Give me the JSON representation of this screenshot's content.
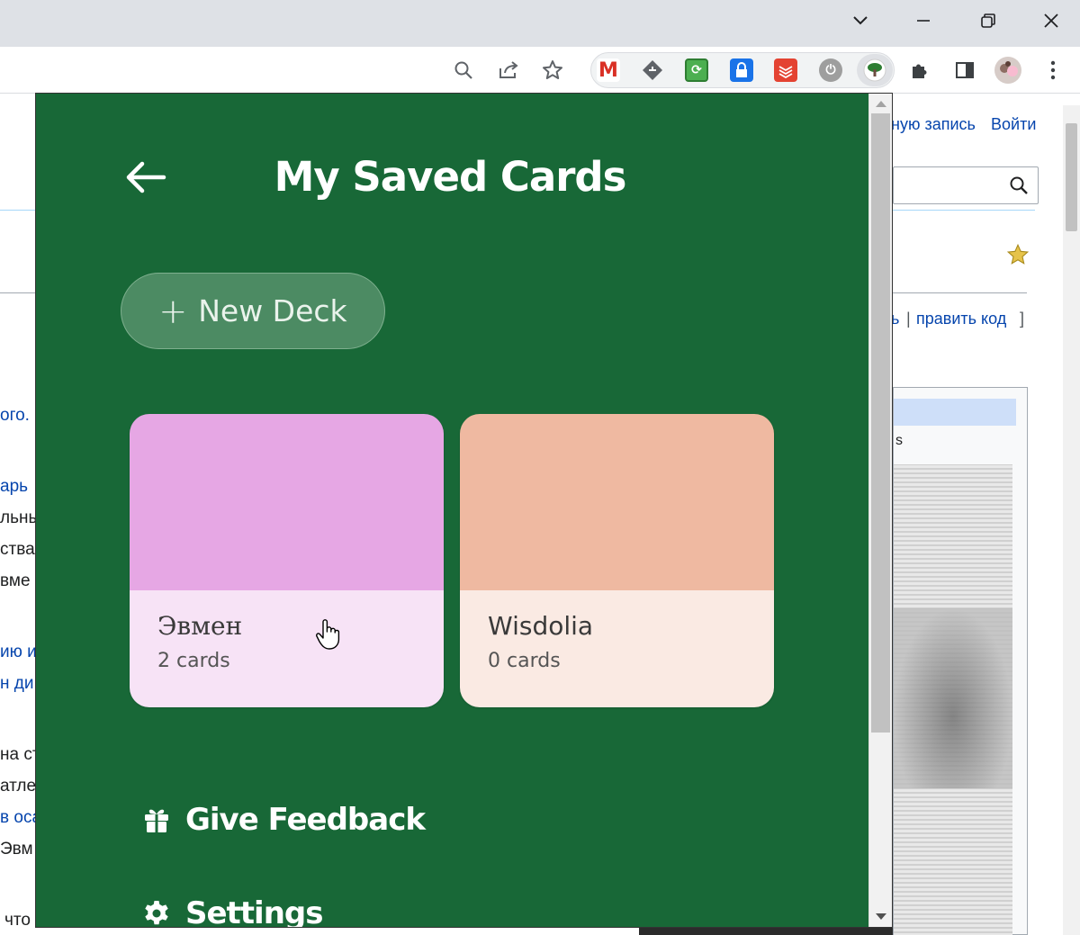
{
  "colors": {
    "popup_bg": "#186837",
    "new_deck_bg": "#4c8b63",
    "deck1_top": "#e6a7e4",
    "deck1_bottom": "#f7e3f6",
    "deck2_top": "#efb9a1",
    "deck2_bottom": "#faeae3"
  },
  "browser": {
    "window_controls": [
      "chevron-down-icon",
      "minimize-icon",
      "restore-icon",
      "close-icon"
    ],
    "toolbar_icons": [
      "zoom-icon",
      "share-icon",
      "bookmark-star-icon"
    ],
    "extensions": [
      "gmail-icon",
      "tag-icon",
      "refresh-ext-icon",
      "lock-ext-icon",
      "todoist-icon",
      "power-icon",
      "tree-icon",
      "puzzle-icon",
      "sidepanel-icon",
      "profile-avatar",
      "kebab-menu-icon"
    ]
  },
  "wiki": {
    "login_partial": "ную запись",
    "login": "Войти",
    "edit_partial": "ь",
    "edit_separator": "|",
    "edit_code": "править код",
    "edit_bracket": "]",
    "infobox_caption_partial": "s",
    "left_fragments": [
      "ого.",
      "арь",
      "льны",
      "ства",
      "вме",
      "ию и",
      "н ди",
      "на ст",
      "атле",
      "в оса",
      "Эвм",
      "что"
    ]
  },
  "popup": {
    "title": "My Saved Cards",
    "new_deck_label": "New Deck",
    "new_deck_icon": "plus-icon",
    "decks": [
      {
        "name": "Эвмен",
        "count": "2 cards"
      },
      {
        "name": "Wisdolia",
        "count": "0 cards"
      }
    ],
    "menu": [
      {
        "icon": "gift-icon",
        "label": "Give Feedback"
      },
      {
        "icon": "gear-icon",
        "label": "Settings"
      }
    ]
  }
}
